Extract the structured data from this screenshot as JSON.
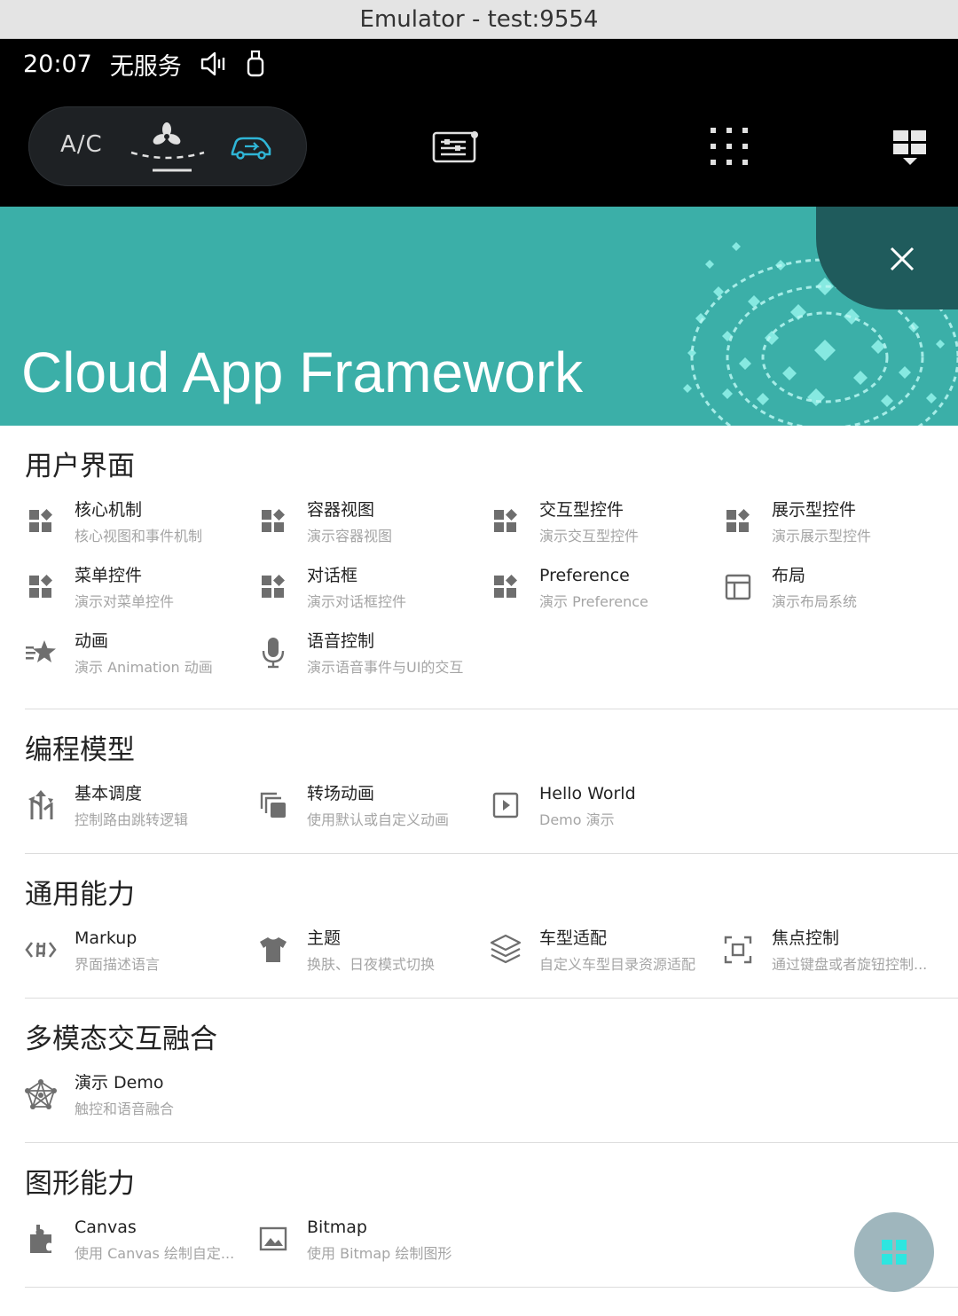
{
  "window": {
    "title": "Emulator - test:9554"
  },
  "status_bar": {
    "time": "20:07",
    "signal": "无服务"
  },
  "system_bar": {
    "ac_label": "A/C"
  },
  "banner": {
    "title": "Cloud App Framework"
  },
  "sections": [
    {
      "title": "用户界面",
      "items": [
        {
          "title": "核心机制",
          "subtitle": "核心视图和事件机制",
          "icon": "widgets-icon"
        },
        {
          "title": "容器视图",
          "subtitle": "演示容器视图",
          "icon": "widgets-icon"
        },
        {
          "title": "交互型控件",
          "subtitle": "演示交互型控件",
          "icon": "widgets-icon"
        },
        {
          "title": "展示型控件",
          "subtitle": "演示展示型控件",
          "icon": "widgets-icon"
        },
        {
          "title": "菜单控件",
          "subtitle": "演示对菜单控件",
          "icon": "widgets-icon"
        },
        {
          "title": "对话框",
          "subtitle": "演示对话框控件",
          "icon": "widgets-icon"
        },
        {
          "title": "Preference",
          "subtitle": "演示 Preference",
          "icon": "widgets-icon"
        },
        {
          "title": "布局",
          "subtitle": "演示布局系统",
          "icon": "layout-icon"
        },
        {
          "title": "动画",
          "subtitle": "演示 Animation 动画",
          "icon": "animation-star-icon"
        },
        {
          "title": "语音控制",
          "subtitle": "演示语音事件与UI的交互",
          "icon": "microphone-icon"
        }
      ]
    },
    {
      "title": "编程模型",
      "items": [
        {
          "title": "基本调度",
          "subtitle": "控制路由跳转逻辑",
          "icon": "routing-arrows-icon"
        },
        {
          "title": "转场动画",
          "subtitle": "使用默认或自定义动画",
          "icon": "transition-icon"
        },
        {
          "title": "Hello World",
          "subtitle": "Demo 演示",
          "icon": "play-box-icon"
        }
      ]
    },
    {
      "title": "通用能力",
      "items": [
        {
          "title": "Markup",
          "subtitle": "界面描述语言",
          "icon": "markup-code-icon"
        },
        {
          "title": "主题",
          "subtitle": "换肤、日夜模式切换",
          "icon": "tshirt-icon"
        },
        {
          "title": "车型适配",
          "subtitle": "自定义车型目录资源适配",
          "icon": "layers-icon"
        },
        {
          "title": "焦点控制",
          "subtitle": "通过键盘或者旋钮控制...",
          "icon": "focus-icon"
        }
      ]
    },
    {
      "title": "多模态交互融合",
      "items": [
        {
          "title": "演示 Demo",
          "subtitle": "触控和语音融合",
          "icon": "network-icon"
        }
      ]
    },
    {
      "title": "图形能力",
      "items": [
        {
          "title": "Canvas",
          "subtitle": "使用 Canvas 绘制自定...",
          "icon": "canvas-puzzle-icon"
        },
        {
          "title": "Bitmap",
          "subtitle": "使用 Bitmap 绘制图形",
          "icon": "image-icon"
        }
      ]
    }
  ],
  "colors": {
    "banner": "#3bafa8",
    "banner_close_bg": "#1f5b5c",
    "icon_gray": "#6e6e6e",
    "fab": "#9fb6bd",
    "fab_icon": "#2ee6e0"
  }
}
